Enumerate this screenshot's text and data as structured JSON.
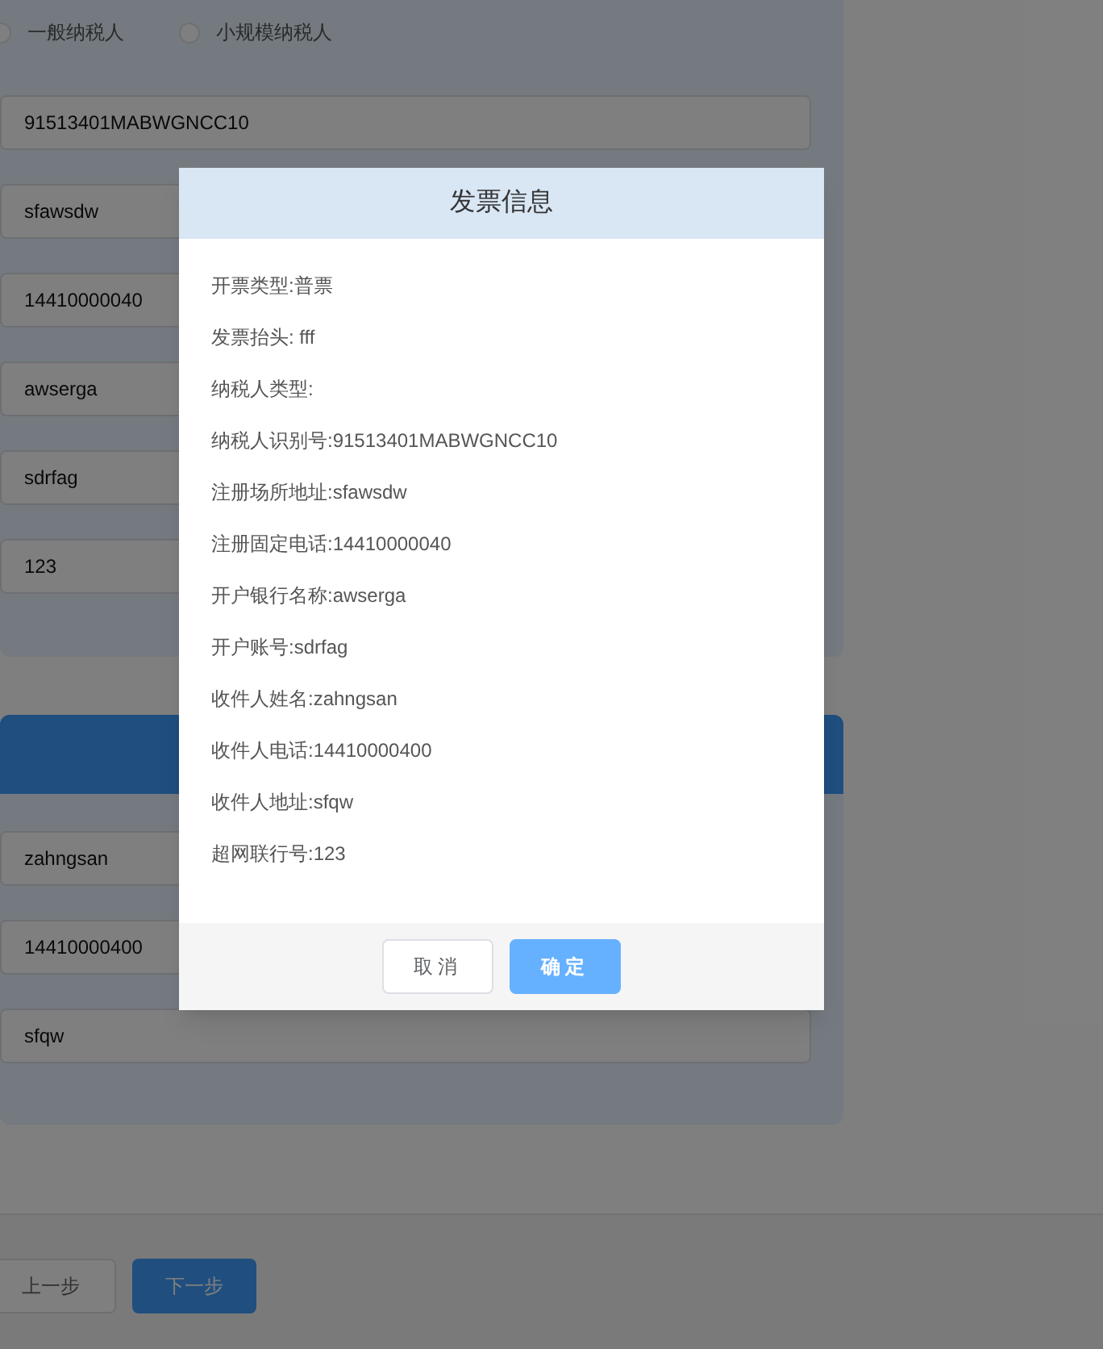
{
  "page": {
    "taxpayer_types": [
      {
        "label": "一般纳税人",
        "selected": false
      },
      {
        "label": "小规模纳税人",
        "selected": false
      }
    ],
    "invoice_fields": [
      "91513401MABWGNCC10",
      "sfawsdw",
      "14410000040",
      "awserga",
      "sdrfag",
      "123"
    ],
    "recipient_fields": [
      "zahngsan",
      "14410000400",
      "sfqw"
    ],
    "prev_button": "上一步",
    "next_button": "下一步"
  },
  "dialog": {
    "title": "发票信息",
    "lines": [
      "开票类型:普票",
      "发票抬头: fff",
      "纳税人类型:",
      "纳税人识别号:91513401MABWGNCC10",
      "注册场所地址:sfawsdw",
      "注册固定电话:14410000040",
      "开户银行名称:awserga",
      "开户账号:sdrfag",
      "收件人姓名:zahngsan",
      "收件人电话:14410000400",
      "收件人地址:sfqw",
      "超网联行号:123"
    ],
    "buttons": [
      {
        "label": "取消",
        "kind": "secondary"
      },
      {
        "label": "确定",
        "kind": "primary"
      }
    ]
  }
}
